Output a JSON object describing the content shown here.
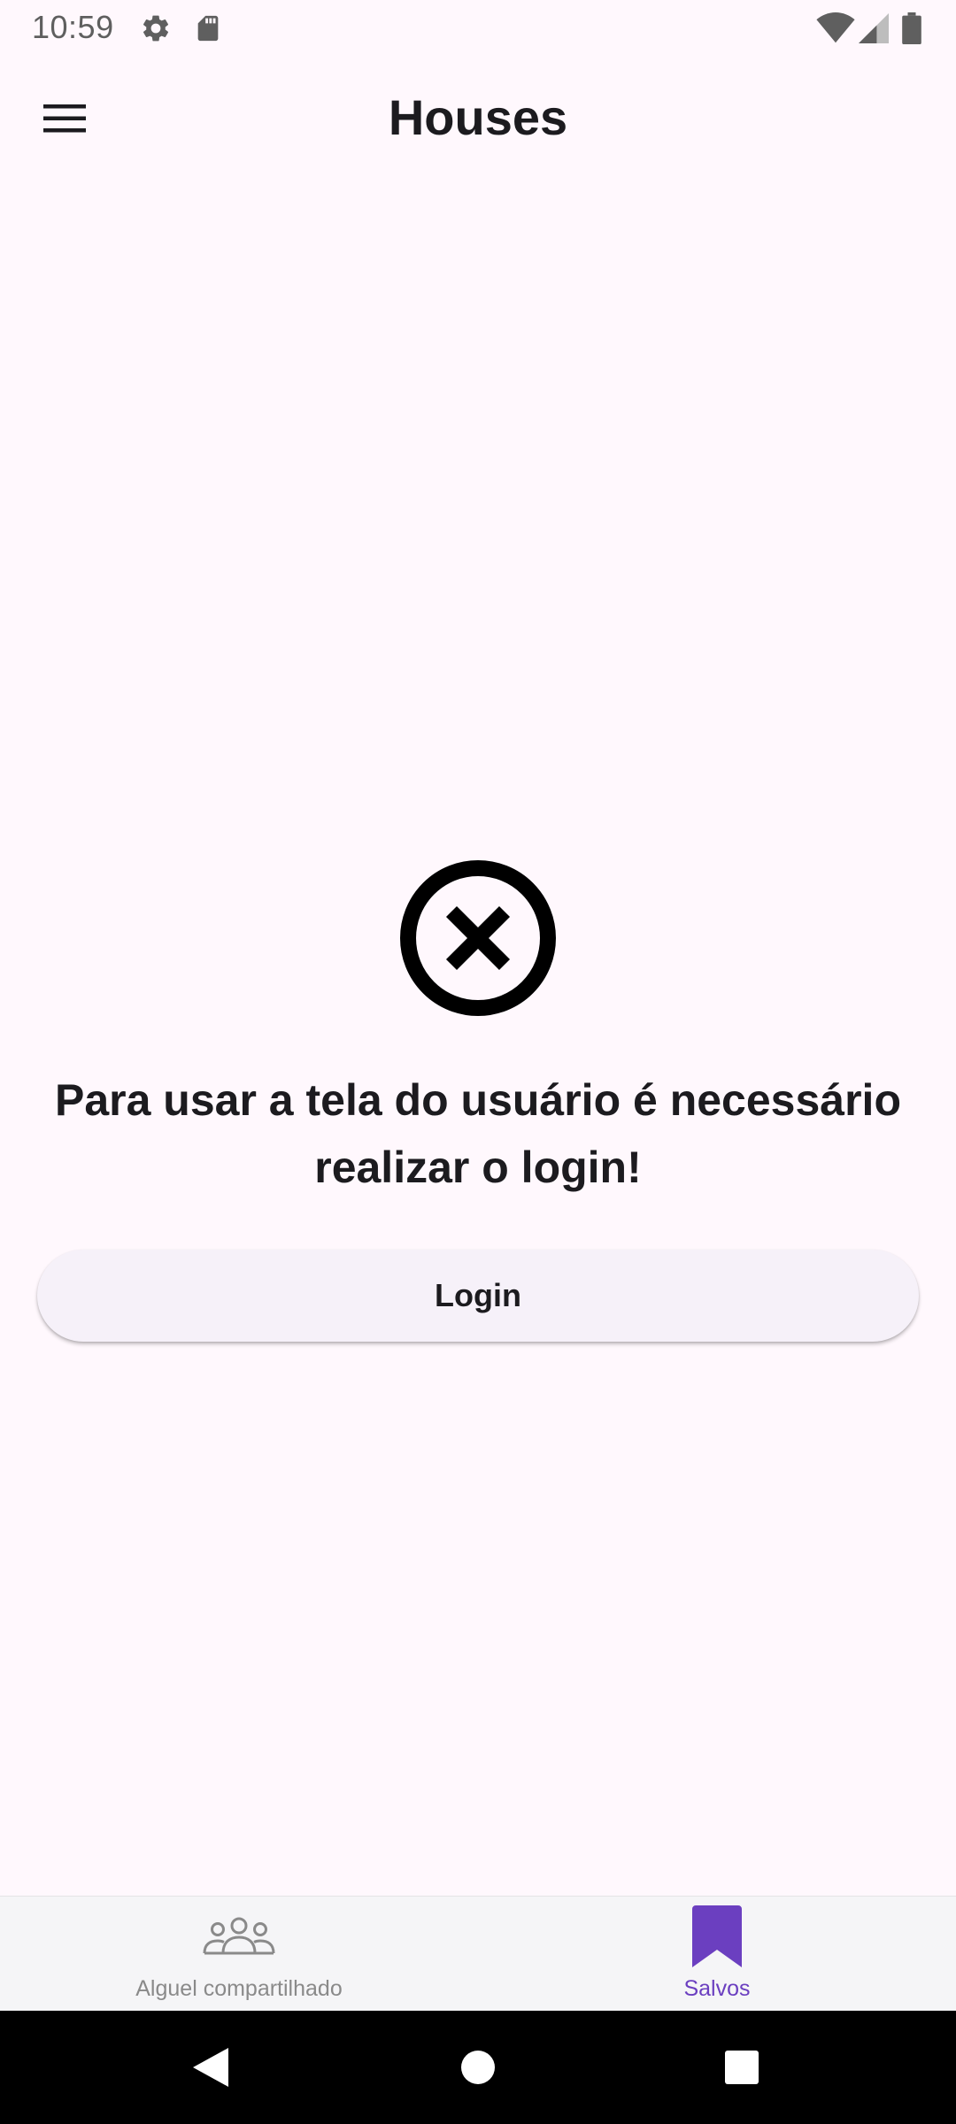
{
  "status_bar": {
    "time": "10:59",
    "icons": [
      "settings-icon",
      "sd-card-icon",
      "wifi-icon",
      "cell-signal-icon",
      "battery-icon"
    ]
  },
  "app_bar": {
    "title": "Houses",
    "menu_icon": "hamburger-menu-icon"
  },
  "main": {
    "error_icon": "cancel-circle-icon",
    "message": "Para usar a tela do usuário é necessário realizar o login!",
    "login_label": "Login"
  },
  "bottom_nav": {
    "items": [
      {
        "label": "Alguel compartilhado",
        "icon": "group-icon",
        "selected": false
      },
      {
        "label": "Salvos",
        "icon": "bookmark-icon",
        "selected": true
      }
    ]
  },
  "colors": {
    "background": "#FFF8FD",
    "accent": "#6B3FC0",
    "inactive": "#8a8a8a"
  }
}
